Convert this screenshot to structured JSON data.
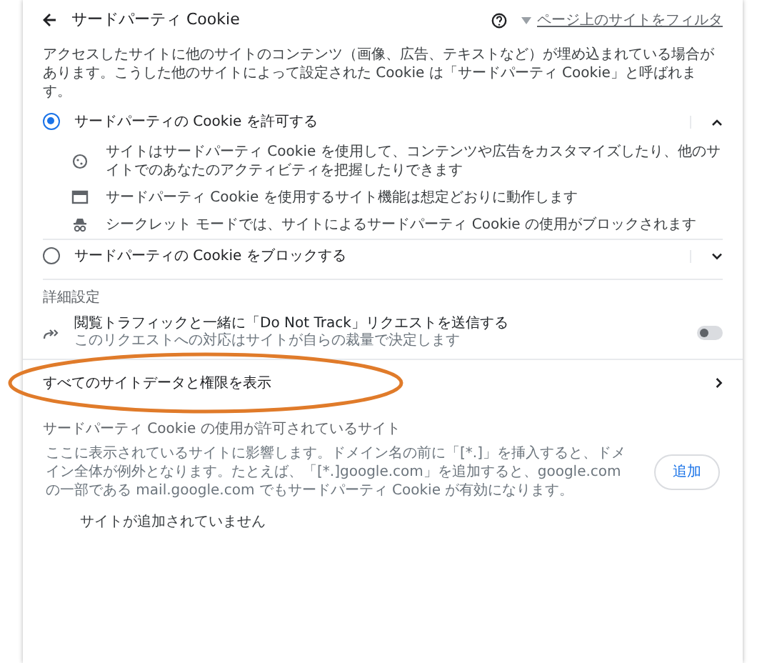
{
  "header": {
    "title": "サードパーティ Cookie",
    "filter_link": "ページ上のサイトをフィルタ"
  },
  "description": "アクセスしたサイトに他のサイトのコンテンツ（画像、広告、テキストなど）が埋め込まれている場合があります。こうした他のサイトによって設定された Cookie は「サードパーティ Cookie」と呼ばれます。",
  "options": [
    {
      "label": "サードパーティの Cookie を許可する",
      "selected": true,
      "expanded": true,
      "details": [
        {
          "kind": "cookie",
          "text": "サイトはサードパーティ Cookie を使用して、コンテンツや広告をカスタマイズしたり、他のサイトでのあなたのアクティビティを把握したりできます"
        },
        {
          "kind": "browser",
          "text": "サードパーティ Cookie を使用するサイト機能は想定どおりに動作します"
        },
        {
          "kind": "incognito",
          "text": "シークレット モードでは、サイトによるサードパーティ Cookie の使用がブロックされます"
        }
      ]
    },
    {
      "label": "サードパーティの Cookie をブロックする",
      "selected": false,
      "expanded": false
    }
  ],
  "advanced": {
    "heading": "詳細設定",
    "dnt": {
      "title": "閲覧トラフィックと一緒に「Do Not Track」リクエストを送信する",
      "subtitle": "このリクエストへの対応はサイトが自らの裁量で決定します",
      "on": false
    }
  },
  "all_site_data": "すべてのサイトデータと権限を表示",
  "allowed": {
    "heading": "サードパーティ Cookie の使用が許可されているサイト",
    "description": "ここに表示されているサイトに影響します。ドメイン名の前に「[*.]」を挿入すると、ドメイン全体が例外となります。たとえば、「[*.]google.com」を追加すると、google.com の一部である mail.google.com でもサードパーティ Cookie が有効になります。",
    "add_button": "追加",
    "empty": "サイトが追加されていません"
  }
}
